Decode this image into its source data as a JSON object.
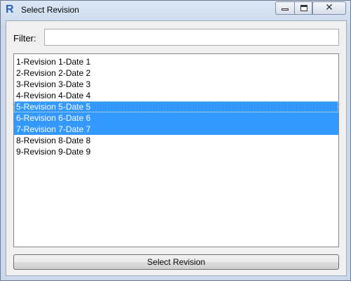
{
  "window": {
    "title": "Select Revision",
    "app_icon": "revit-icon",
    "app_icon_letter": "R"
  },
  "controls": {
    "minimize": "minimize-icon",
    "maximize": "maximize-icon",
    "close": "close-icon",
    "close_glyph": "✕"
  },
  "filter": {
    "label": "Filter:",
    "value": "",
    "placeholder": ""
  },
  "revisions": {
    "items": [
      {
        "label": "1-Revision 1-Date 1",
        "selected": false
      },
      {
        "label": "2-Revision 2-Date 2",
        "selected": false
      },
      {
        "label": "3-Revision 3-Date 3",
        "selected": false
      },
      {
        "label": "4-Revision 4-Date 4",
        "selected": false
      },
      {
        "label": "5-Revision 5-Date 5",
        "selected": true,
        "focused": true
      },
      {
        "label": "6-Revision 6-Date 6",
        "selected": true
      },
      {
        "label": "7-Revision 7-Date 7",
        "selected": true
      },
      {
        "label": "8-Revision 8-Date 8",
        "selected": false
      },
      {
        "label": "9-Revision 9-Date 9",
        "selected": false
      }
    ]
  },
  "actions": {
    "select_label": "Select Revision"
  },
  "colors": {
    "selection": "#3399ff",
    "selection_text": "#ffffff"
  }
}
